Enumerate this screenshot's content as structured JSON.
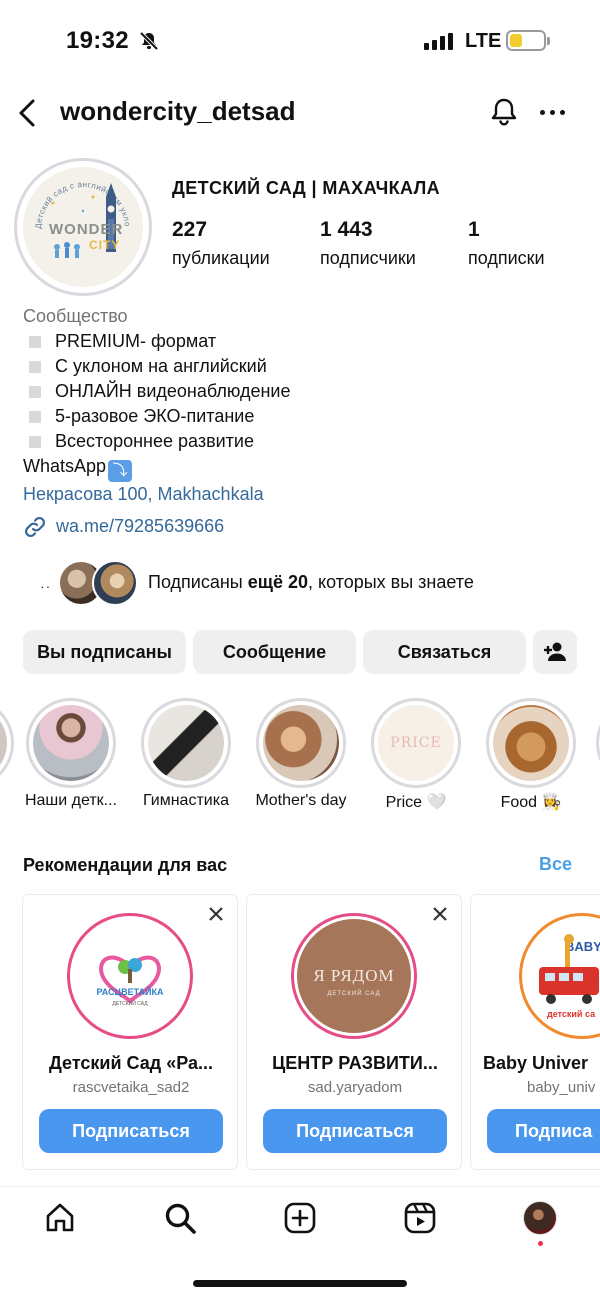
{
  "status_bar": {
    "time": "19:32",
    "network": "LTE",
    "battery_color": "#f2cc2e"
  },
  "header": {
    "username": "wondercity_detsad"
  },
  "profile": {
    "display_name": "ДЕТСКИЙ САД | МАХАЧКАЛА",
    "stats": [
      {
        "value": "227",
        "label": "публикации"
      },
      {
        "value": "1 443",
        "label": "подписчики"
      },
      {
        "value": "1",
        "label": "подписки"
      }
    ],
    "avatar_logo": {
      "word1": "WONDER",
      "word2": "CITY",
      "arc_text": "Детский сад с английским уклоном"
    }
  },
  "bio": {
    "category": "Сообщество",
    "lines": [
      "PREMIUM- формат",
      "С уклоном на английский",
      "ОНЛАЙН видеонаблюдение",
      "5-разовое ЭКО-питание",
      "Всестороннее развитие"
    ],
    "whatsapp": "WhatsApp",
    "whatsapp_emoji": "⤵️",
    "address": "Некрасова 100, Makhachkala",
    "link": "wa.me/79285639666"
  },
  "mutual": {
    "dots": "··",
    "prefix": "Подписаны ",
    "bold": "ещё 20",
    "suffix": ", которых вы знаете"
  },
  "actions": {
    "following": "Вы подписаны",
    "message": "Сообщение",
    "contact": "Связаться"
  },
  "highlights": [
    {
      "label": "Наши детк..."
    },
    {
      "label": "Гимнастика"
    },
    {
      "label": "Mother's day"
    },
    {
      "label": "Price 🤍"
    },
    {
      "label": "Food 👩‍🍳"
    }
  ],
  "highlight_partial_label": "...",
  "recommendations": {
    "title": "Рекомендации для вас",
    "see_all": "Все",
    "cards": [
      {
        "name": "Детский Сад «Ра...",
        "handle": "rascvetaika_sad2",
        "button": "Подписаться",
        "logo_text": "РАСЦВЕТАЙКА",
        "logo_sub": "ДЕТСКИЙ САД"
      },
      {
        "name": "ЦЕНТР РАЗВИТИ...",
        "handle": "sad.yaryadom",
        "button": "Подписаться",
        "logo_text": "Я РЯДОМ",
        "logo_sub": "ДЕТСКИЙ САД"
      },
      {
        "name": "Baby Univer",
        "handle": "baby_univ",
        "button": "Подписа",
        "logo_text": "BABY UNI",
        "logo_sub": "детский са"
      }
    ]
  },
  "colors": {
    "link": "#35689b",
    "accent": "#4a97ef",
    "button_bg": "#efefef",
    "ring_brand": "#e64c86"
  }
}
